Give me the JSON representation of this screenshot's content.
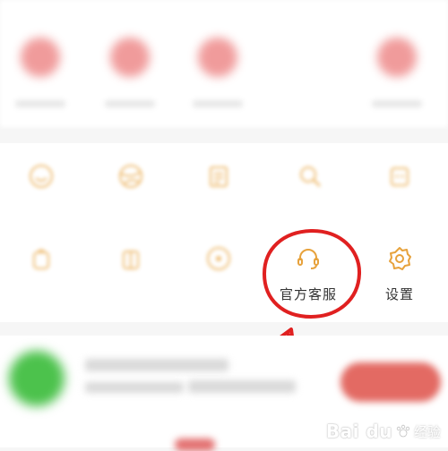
{
  "colors": {
    "accent_orange": "#e7a23c",
    "annotation_red": "#e02020",
    "blurred_red": "#ee8a8a",
    "blurred_green": "#4cc24c"
  },
  "order_row": [
    {
      "icon": "order-status-icon"
    },
    {
      "icon": "order-status-icon"
    },
    {
      "icon": "order-status-icon"
    },
    {
      "icon": "order-status-icon"
    }
  ],
  "service_grid": {
    "row1": [
      {
        "icon": "face-icon",
        "label": ""
      },
      {
        "icon": "globe-icon",
        "label": ""
      },
      {
        "icon": "calendar-icon",
        "label": ""
      },
      {
        "icon": "search-star-icon",
        "label": ""
      },
      {
        "icon": "cart-icon",
        "label": ""
      }
    ],
    "row2": [
      {
        "icon": "bag-icon",
        "label": ""
      },
      {
        "icon": "gift-icon",
        "label": ""
      },
      {
        "icon": "location-icon",
        "label": ""
      },
      {
        "icon": "headset-icon",
        "label": "官方客服"
      },
      {
        "icon": "gear-icon",
        "label": "设置"
      }
    ]
  },
  "watermark": {
    "main": "Bai du",
    "sub": "经验"
  }
}
